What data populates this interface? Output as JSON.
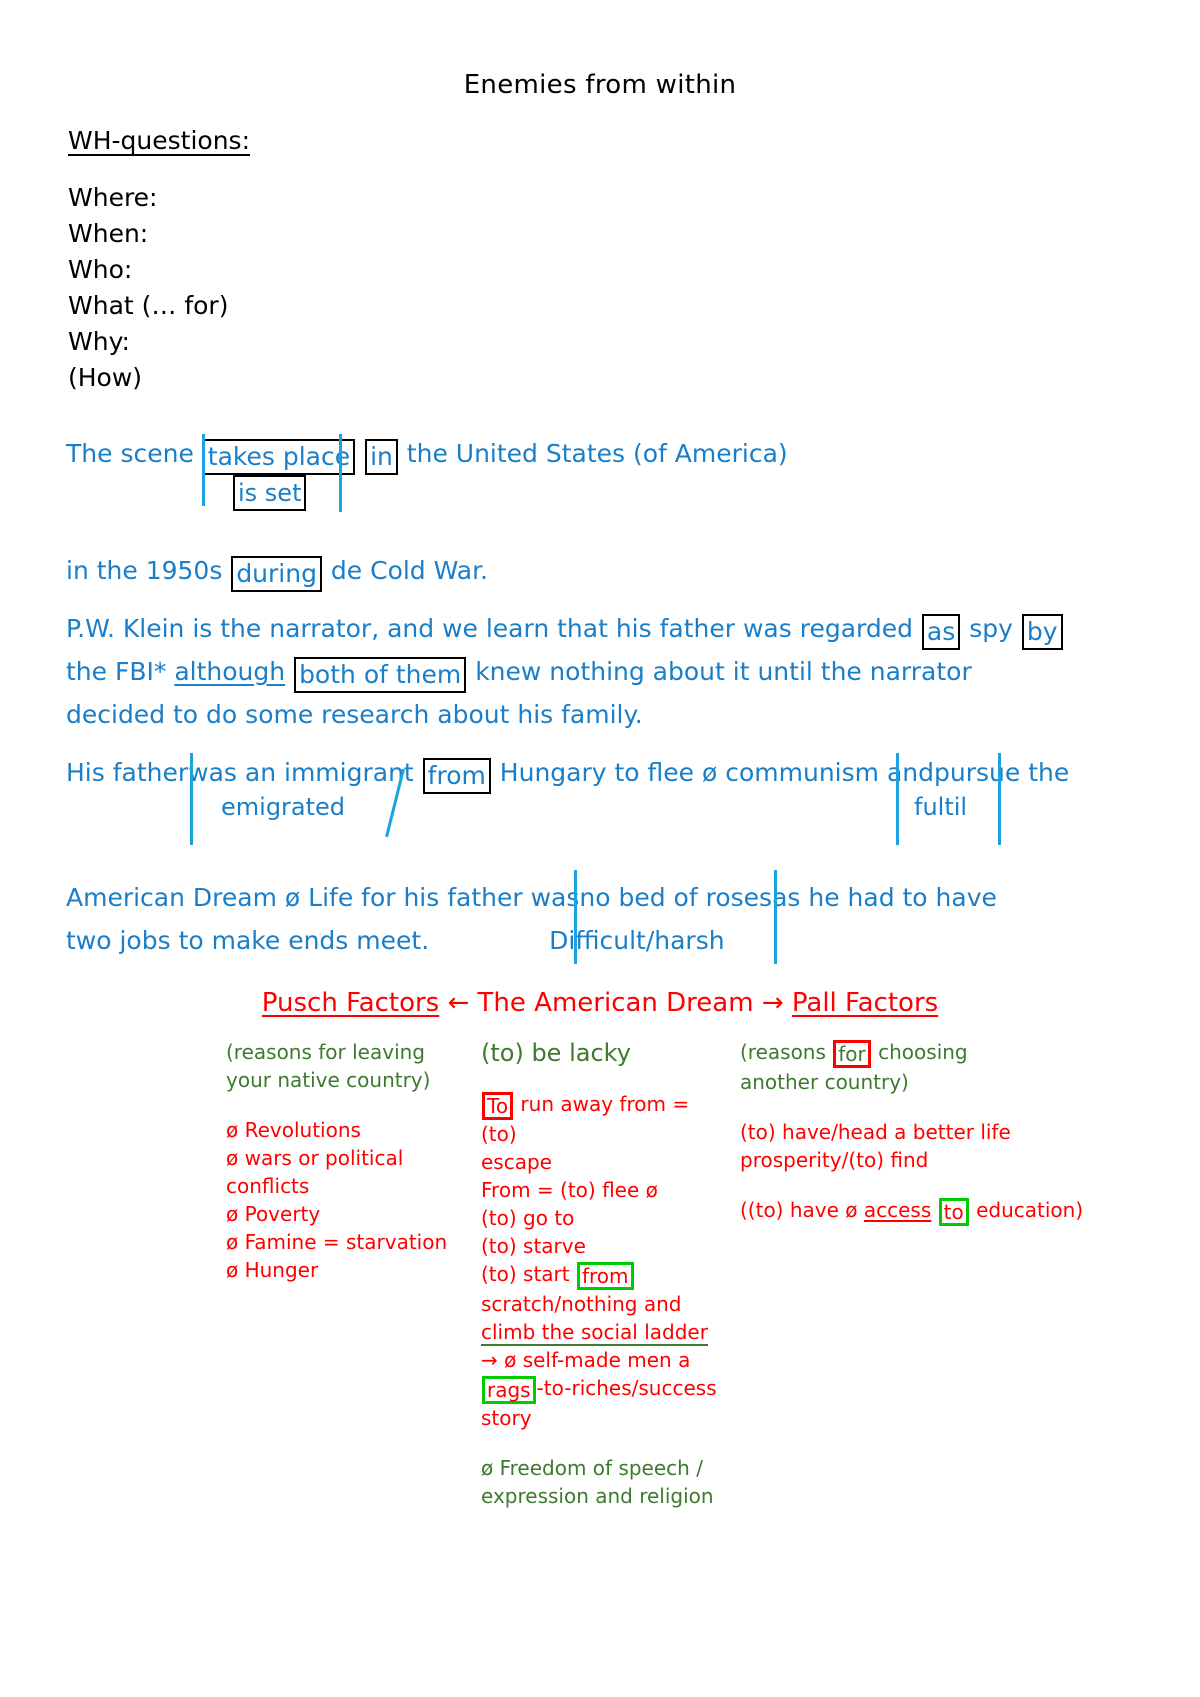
{
  "document": {
    "title": "Enemies from within"
  },
  "wh_section": {
    "heading": "WH-questions:",
    "items": [
      "Where:",
      "When:",
      "Who:",
      "What (… for)",
      "Why:",
      "(How)"
    ]
  },
  "colors": {
    "black": "#000000",
    "blue": "#1a7ec8",
    "blue_stroke": "#1aa3e0",
    "red": "#ff0000",
    "green": "#3d7a2e",
    "green_box": "#00cc00"
  },
  "summary": {
    "p1": {
      "seg_a": "The scene ",
      "box_takes_place": "takes place",
      "box_in": "in",
      "seg_b": " the United States (of America)",
      "correction_is_set": "is set"
    },
    "p2": {
      "seg_a": "in the 1950s ",
      "box_during": "during",
      "seg_b": " de Cold War."
    },
    "p3": {
      "seg_a": "P.W. Klein is the narrator, and we learn that his father was regarded ",
      "box_as": "as",
      "seg_b": " spy ",
      "box_by": "by",
      "line2_a": "the FBI* ",
      "underline_although": "although",
      "box_both_of_them": "both of them",
      "line2_b": " knew nothing about it until the narrator",
      "line3": "decided to do some research about his family."
    },
    "p4": {
      "seg_a": "His father",
      "seg_b": "was an immigrant ",
      "box_from": "from",
      "seg_c": " Hungary to flee ø communism and",
      "seg_d": "pursue",
      "seg_e": " the",
      "correction_emigrated": "emigrated",
      "correction_fultil": "fultil"
    },
    "p5": {
      "seg_a": "American Dream ø Life for his father was",
      "seg_b": "no bed of roses",
      "seg_c": "as he had to have",
      "line2": "two jobs to make ends meet.",
      "correction_difficult": "Difficult/harsh"
    }
  },
  "factors": {
    "header": {
      "left_label": "Pusch Factors",
      "left_arrow": "←",
      "center_label": "The American Dream",
      "right_arrow": "→",
      "right_label": "Pall Factors"
    },
    "left_column": {
      "subtitle": "(reasons for leaving\nyour native country)",
      "bullets": [
        "ø Revolutions",
        "ø wars or political",
        "conflicts",
        "ø Poverty",
        "ø Famine = starvation",
        "ø Hunger"
      ]
    },
    "middle_column": {
      "title": "(to) be lacky",
      "line1_box": "To",
      "line1_rest": " run away from = (to)",
      "line2": "escape",
      "line3": "From = (to) flee ø",
      "line4": "(to) go to",
      "line5": "(to) starve",
      "line6_a": "(to) start ",
      "line6_box": "from",
      "line7": "scratch/nothing and",
      "line8_underlined": "climb the social ladder",
      "line9": "→ ø self-made men a",
      "line10_box": "rags",
      "line10_rest": "-to-riches/success",
      "line11": "story",
      "green_note": "ø Freedom of speech /\nexpression and religion"
    },
    "right_column": {
      "subtitle_a": "(reasons ",
      "subtitle_box": "for",
      "subtitle_b": " choosing",
      "subtitle_c": "another country)",
      "line1": "(to) have/head a better life",
      "line2": "prosperity/(to) find",
      "line3_a": "((to) have ø ",
      "line3_underlined": "access",
      "line3_box": "to",
      "line3_b": " education)"
    }
  }
}
